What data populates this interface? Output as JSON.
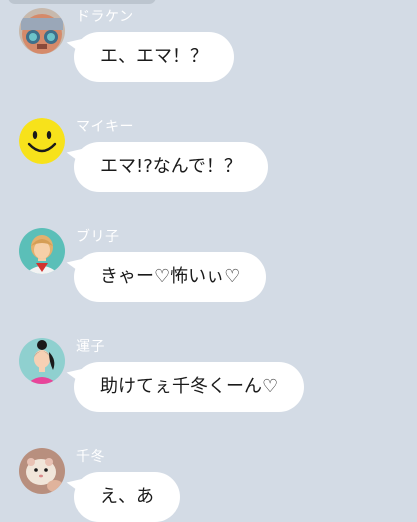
{
  "messages": [
    {
      "sender": "ドラケン",
      "text": "エ、エマ！？",
      "avatar": "draken-avatar"
    },
    {
      "sender": "マイキー",
      "text": "エマ!?なんで！？",
      "avatar": "smiley-avatar"
    },
    {
      "sender": "ブリ子",
      "text": "きゃー♡怖いぃ♡",
      "avatar": "schoolgirl-avatar"
    },
    {
      "sender": "運子",
      "text": "助けてぇ千冬くーん♡",
      "avatar": "ponytail-girl-avatar"
    },
    {
      "sender": "千冬",
      "text": "え、あ",
      "avatar": "hamster-avatar"
    }
  ],
  "colors": {
    "background": "#d3dbe5",
    "bubble": "#ffffff",
    "name_text": "#ffffff"
  }
}
